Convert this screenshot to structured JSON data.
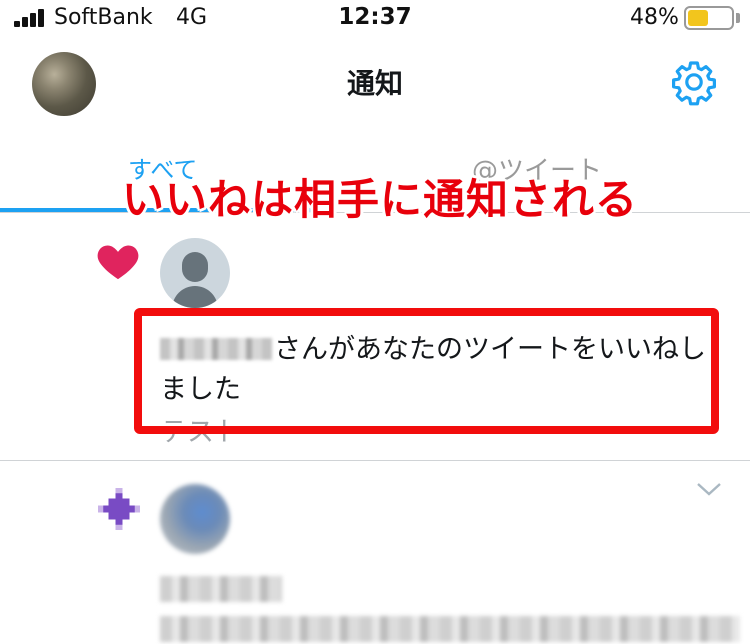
{
  "status_bar": {
    "carrier": "SoftBank",
    "network": "4G",
    "time": "12:37",
    "battery_percent": "48%",
    "battery_level": 0.48,
    "battery_color": "#f2c51d"
  },
  "header": {
    "title": "通知",
    "settings_icon": "gear-icon"
  },
  "tabs": {
    "all_label": "すべて",
    "mentions_label": "@ツイート",
    "active": "all",
    "accent_color": "#1da1f2"
  },
  "overlay": {
    "caption": "いいねは相手に通知される",
    "caption_color": "#e8000b",
    "highlight_color": "#f20d0d"
  },
  "notifications": [
    {
      "icon": "heart-icon",
      "icon_color": "#e0245e",
      "username_blurred": true,
      "message": "さんがあなたのツイートをいいねしました",
      "tweet_text": "テスト"
    },
    {
      "icon": "sparkle-icon",
      "icon_color": "#794bc4",
      "content_blurred": true
    }
  ]
}
